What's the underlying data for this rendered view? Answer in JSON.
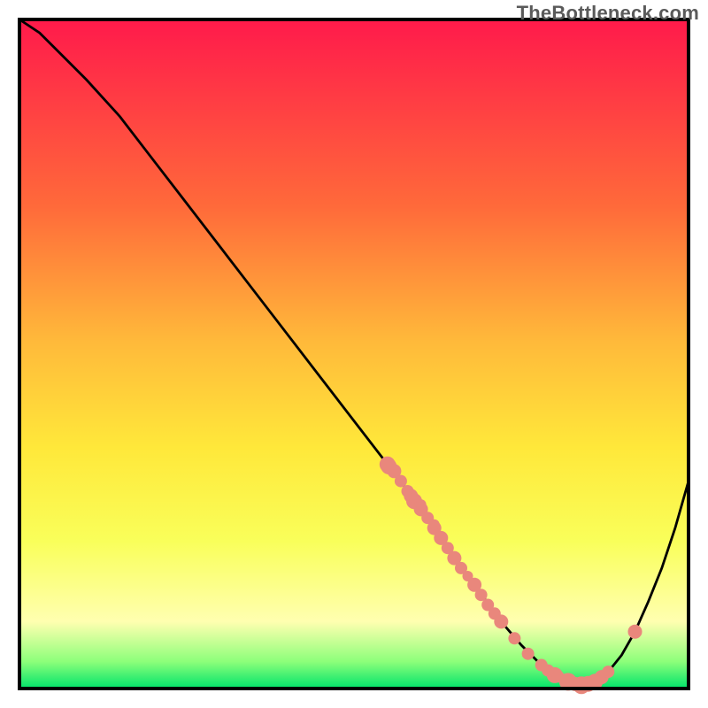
{
  "attribution": "TheBottleneck.com",
  "chart_data": {
    "type": "line",
    "title": "",
    "xlabel": "",
    "ylabel": "",
    "xlim": [
      0,
      100
    ],
    "ylim": [
      0,
      100
    ],
    "x": [
      0,
      3,
      6,
      10,
      15,
      20,
      25,
      30,
      35,
      40,
      45,
      50,
      55,
      60,
      64,
      68,
      72,
      75,
      78,
      80,
      82,
      84,
      86,
      88,
      90,
      92,
      94,
      96,
      98,
      100
    ],
    "values": [
      100,
      98,
      95,
      91,
      85.5,
      79,
      72.5,
      66,
      59.5,
      53,
      46.5,
      40,
      33.5,
      27,
      21,
      15.5,
      10,
      6.5,
      3.5,
      2,
      1,
      0.5,
      1,
      2.5,
      5,
      8.5,
      13,
      18,
      24,
      31
    ],
    "series": [
      {
        "name": "data-points",
        "color": "#e9877c",
        "points": [
          {
            "x": 55,
            "y": 33.5,
            "r": 9
          },
          {
            "x": 55.2,
            "y": 33.2,
            "r": 9
          },
          {
            "x": 56,
            "y": 32.5,
            "r": 8
          },
          {
            "x": 57,
            "y": 31,
            "r": 7
          },
          {
            "x": 58,
            "y": 29.5,
            "r": 7
          },
          {
            "x": 58.5,
            "y": 28.8,
            "r": 8
          },
          {
            "x": 59,
            "y": 28,
            "r": 9
          },
          {
            "x": 59,
            "y": 28.5,
            "r": 6
          },
          {
            "x": 60,
            "y": 26.8,
            "r": 8
          },
          {
            "x": 60,
            "y": 27.5,
            "r": 6
          },
          {
            "x": 61,
            "y": 25.5,
            "r": 7
          },
          {
            "x": 62,
            "y": 24,
            "r": 8
          },
          {
            "x": 62,
            "y": 24.5,
            "r": 6
          },
          {
            "x": 63,
            "y": 22.5,
            "r": 8
          },
          {
            "x": 64,
            "y": 21,
            "r": 7
          },
          {
            "x": 65,
            "y": 19.5,
            "r": 8
          },
          {
            "x": 66,
            "y": 18,
            "r": 7
          },
          {
            "x": 67,
            "y": 16.8,
            "r": 6
          },
          {
            "x": 68,
            "y": 15.5,
            "r": 8
          },
          {
            "x": 69,
            "y": 14,
            "r": 7
          },
          {
            "x": 70,
            "y": 12.5,
            "r": 7
          },
          {
            "x": 71,
            "y": 11.2,
            "r": 7
          },
          {
            "x": 72,
            "y": 10,
            "r": 8
          },
          {
            "x": 74,
            "y": 7.5,
            "r": 7
          },
          {
            "x": 76,
            "y": 5.2,
            "r": 7
          },
          {
            "x": 78,
            "y": 3.5,
            "r": 7
          },
          {
            "x": 79,
            "y": 2.7,
            "r": 7
          },
          {
            "x": 80,
            "y": 2,
            "r": 9
          },
          {
            "x": 80.5,
            "y": 1.8,
            "r": 7
          },
          {
            "x": 82,
            "y": 1,
            "r": 10
          },
          {
            "x": 83,
            "y": 0.7,
            "r": 8
          },
          {
            "x": 84,
            "y": 0.5,
            "r": 10
          },
          {
            "x": 85,
            "y": 0.7,
            "r": 9
          },
          {
            "x": 86,
            "y": 1,
            "r": 9
          },
          {
            "x": 87,
            "y": 1.7,
            "r": 8
          },
          {
            "x": 88,
            "y": 2.5,
            "r": 7
          },
          {
            "x": 92,
            "y": 8.5,
            "r": 8
          }
        ]
      }
    ]
  }
}
